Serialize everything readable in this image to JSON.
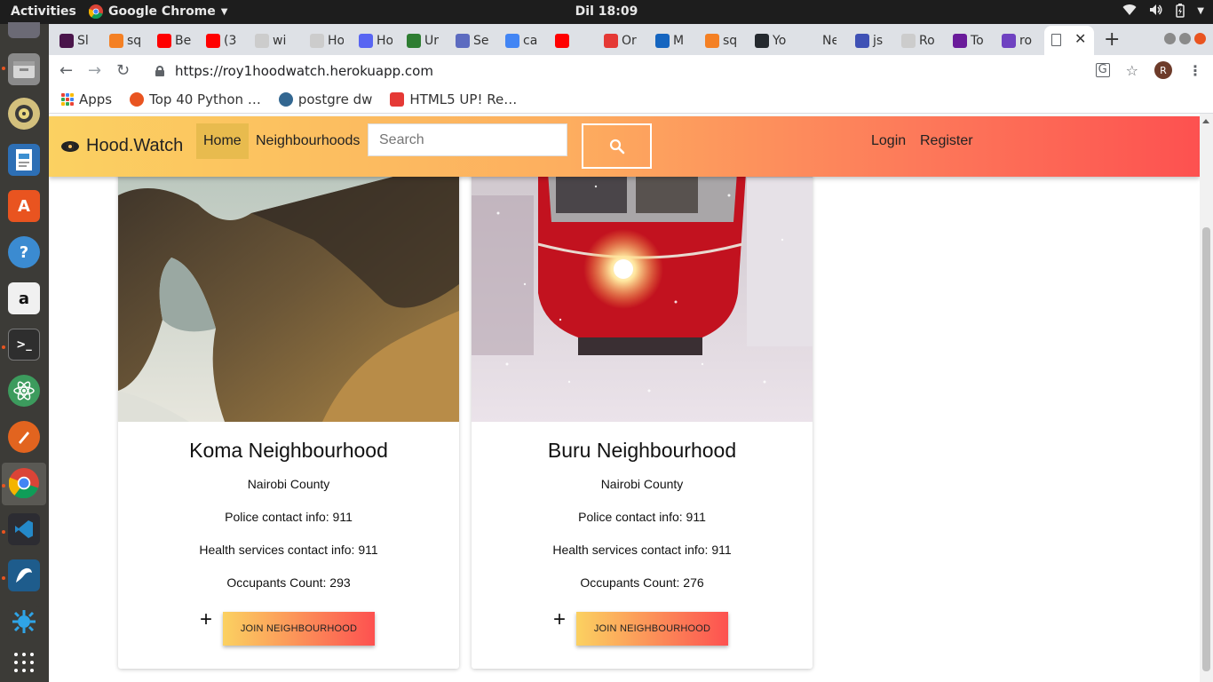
{
  "os": {
    "activities": "Activities",
    "app_menu": "Google Chrome",
    "clock": "Dil 18:09"
  },
  "browser": {
    "tabs": [
      {
        "label": "Sl",
        "icon_color": "#4a154b"
      },
      {
        "label": "sq",
        "icon_color": "#f48024"
      },
      {
        "label": "Be",
        "icon_color": "#ff0000"
      },
      {
        "label": "(3",
        "icon_color": "#ff0000"
      },
      {
        "label": "wi",
        "icon_color": "#cccccc"
      },
      {
        "label": "Ho",
        "icon_color": "#cccccc"
      },
      {
        "label": "Ho",
        "icon_color": "#5865f2"
      },
      {
        "label": "Ur",
        "icon_color": "#2e7d32"
      },
      {
        "label": "Se",
        "icon_color": "#5c6bc0"
      },
      {
        "label": "ca",
        "icon_color": "#4285f4"
      },
      {
        "label": "",
        "icon_color": "#ff0000"
      },
      {
        "label": "Or",
        "icon_color": "#e53935"
      },
      {
        "label": "M",
        "icon_color": "#1565c0"
      },
      {
        "label": "sq",
        "icon_color": "#f48024"
      },
      {
        "label": "Yo",
        "icon_color": "#24292e"
      },
      {
        "label": "New T",
        "icon_color": "#dee1e6"
      },
      {
        "label": "js",
        "icon_color": "#3f51b5"
      },
      {
        "label": "Ro",
        "icon_color": "#cccccc"
      },
      {
        "label": "To",
        "icon_color": "#6a1b9a"
      },
      {
        "label": "ro",
        "icon_color": "#6f42c1"
      }
    ],
    "url": "https://roy1hoodwatch.herokuapp.com",
    "avatar_initial": "R",
    "bookmarks": {
      "apps": "Apps",
      "items": [
        {
          "label": "Top 40 Python …",
          "icon_color": "#e95420"
        },
        {
          "label": "postgre dw",
          "icon_color": "#336791"
        },
        {
          "label": "HTML5 UP! Re…",
          "icon_color": "#e53935"
        }
      ]
    }
  },
  "site": {
    "brand": "Hood.Watch",
    "nav": {
      "home": "Home",
      "neighbourhoods": "Neighbourhoods",
      "login": "Login",
      "register": "Register"
    },
    "search": {
      "placeholder": "Search",
      "value": ""
    },
    "gradient": {
      "start": "#fbd161",
      "end": "#fd5150"
    },
    "cards": [
      {
        "title": "Koma Neighbourhood",
        "county": "Nairobi County",
        "police": "Police contact info: 911",
        "health": "Health services contact info: 911",
        "occupants": "Occupants Count: 293",
        "plus": "+",
        "join_label": "JOIN NEIGHBOURHOOD"
      },
      {
        "title": "Buru Neighbourhood",
        "county": "Nairobi County",
        "police": "Police contact info: 911",
        "health": "Health services contact info: 911",
        "occupants": "Occupants Count: 276",
        "plus": "+",
        "join_label": "JOIN NEIGHBOURHOOD"
      }
    ]
  }
}
